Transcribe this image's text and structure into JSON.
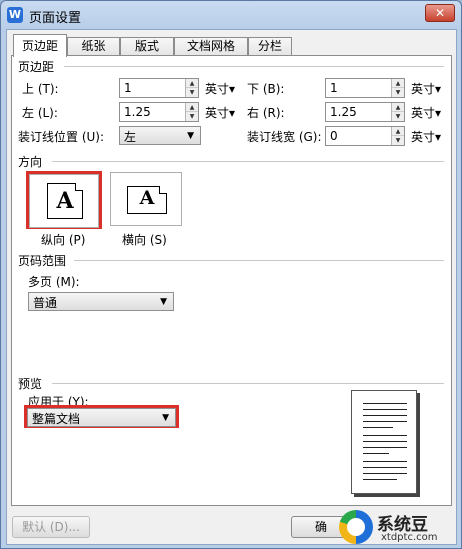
{
  "window": {
    "title": "页面设置",
    "app_icon_text": "W",
    "close_label": "✕"
  },
  "tabs": [
    "页边距",
    "纸张",
    "版式",
    "文档网格",
    "分栏"
  ],
  "margins": {
    "section_title": "页边距",
    "top": {
      "label": "上 (T):",
      "value": "1",
      "unit": "英寸▾"
    },
    "bottom": {
      "label": "下 (B):",
      "value": "1",
      "unit": "英寸▾"
    },
    "left": {
      "label": "左 (L):",
      "value": "1.25",
      "unit": "英寸▾"
    },
    "right": {
      "label": "右 (R):",
      "value": "1.25",
      "unit": "英寸▾"
    },
    "gutter_position": {
      "label": "装订线位置 (U):",
      "value": "左"
    },
    "gutter_width": {
      "label": "装订线宽 (G):",
      "value": "0",
      "unit": "英寸▾"
    }
  },
  "orientation": {
    "section_title": "方向",
    "portrait": {
      "label": "纵向 (P)",
      "letter": "A"
    },
    "landscape": {
      "label": "横向 (S)",
      "letter": "A"
    }
  },
  "page_range": {
    "section_title": "页码范围",
    "multi_label": "多页 (M):",
    "multi_value": "普通"
  },
  "preview": {
    "section_title": "预览",
    "apply_label": "应用于 (Y):",
    "apply_value": "整篇文档"
  },
  "buttons": {
    "default": "默认 (D)...",
    "ok": "确"
  },
  "watermark": {
    "name": "系统豆",
    "url": "xtdptc.com"
  },
  "colors": {
    "highlight": "#d9302c",
    "title_bar": "#b7cde8"
  }
}
